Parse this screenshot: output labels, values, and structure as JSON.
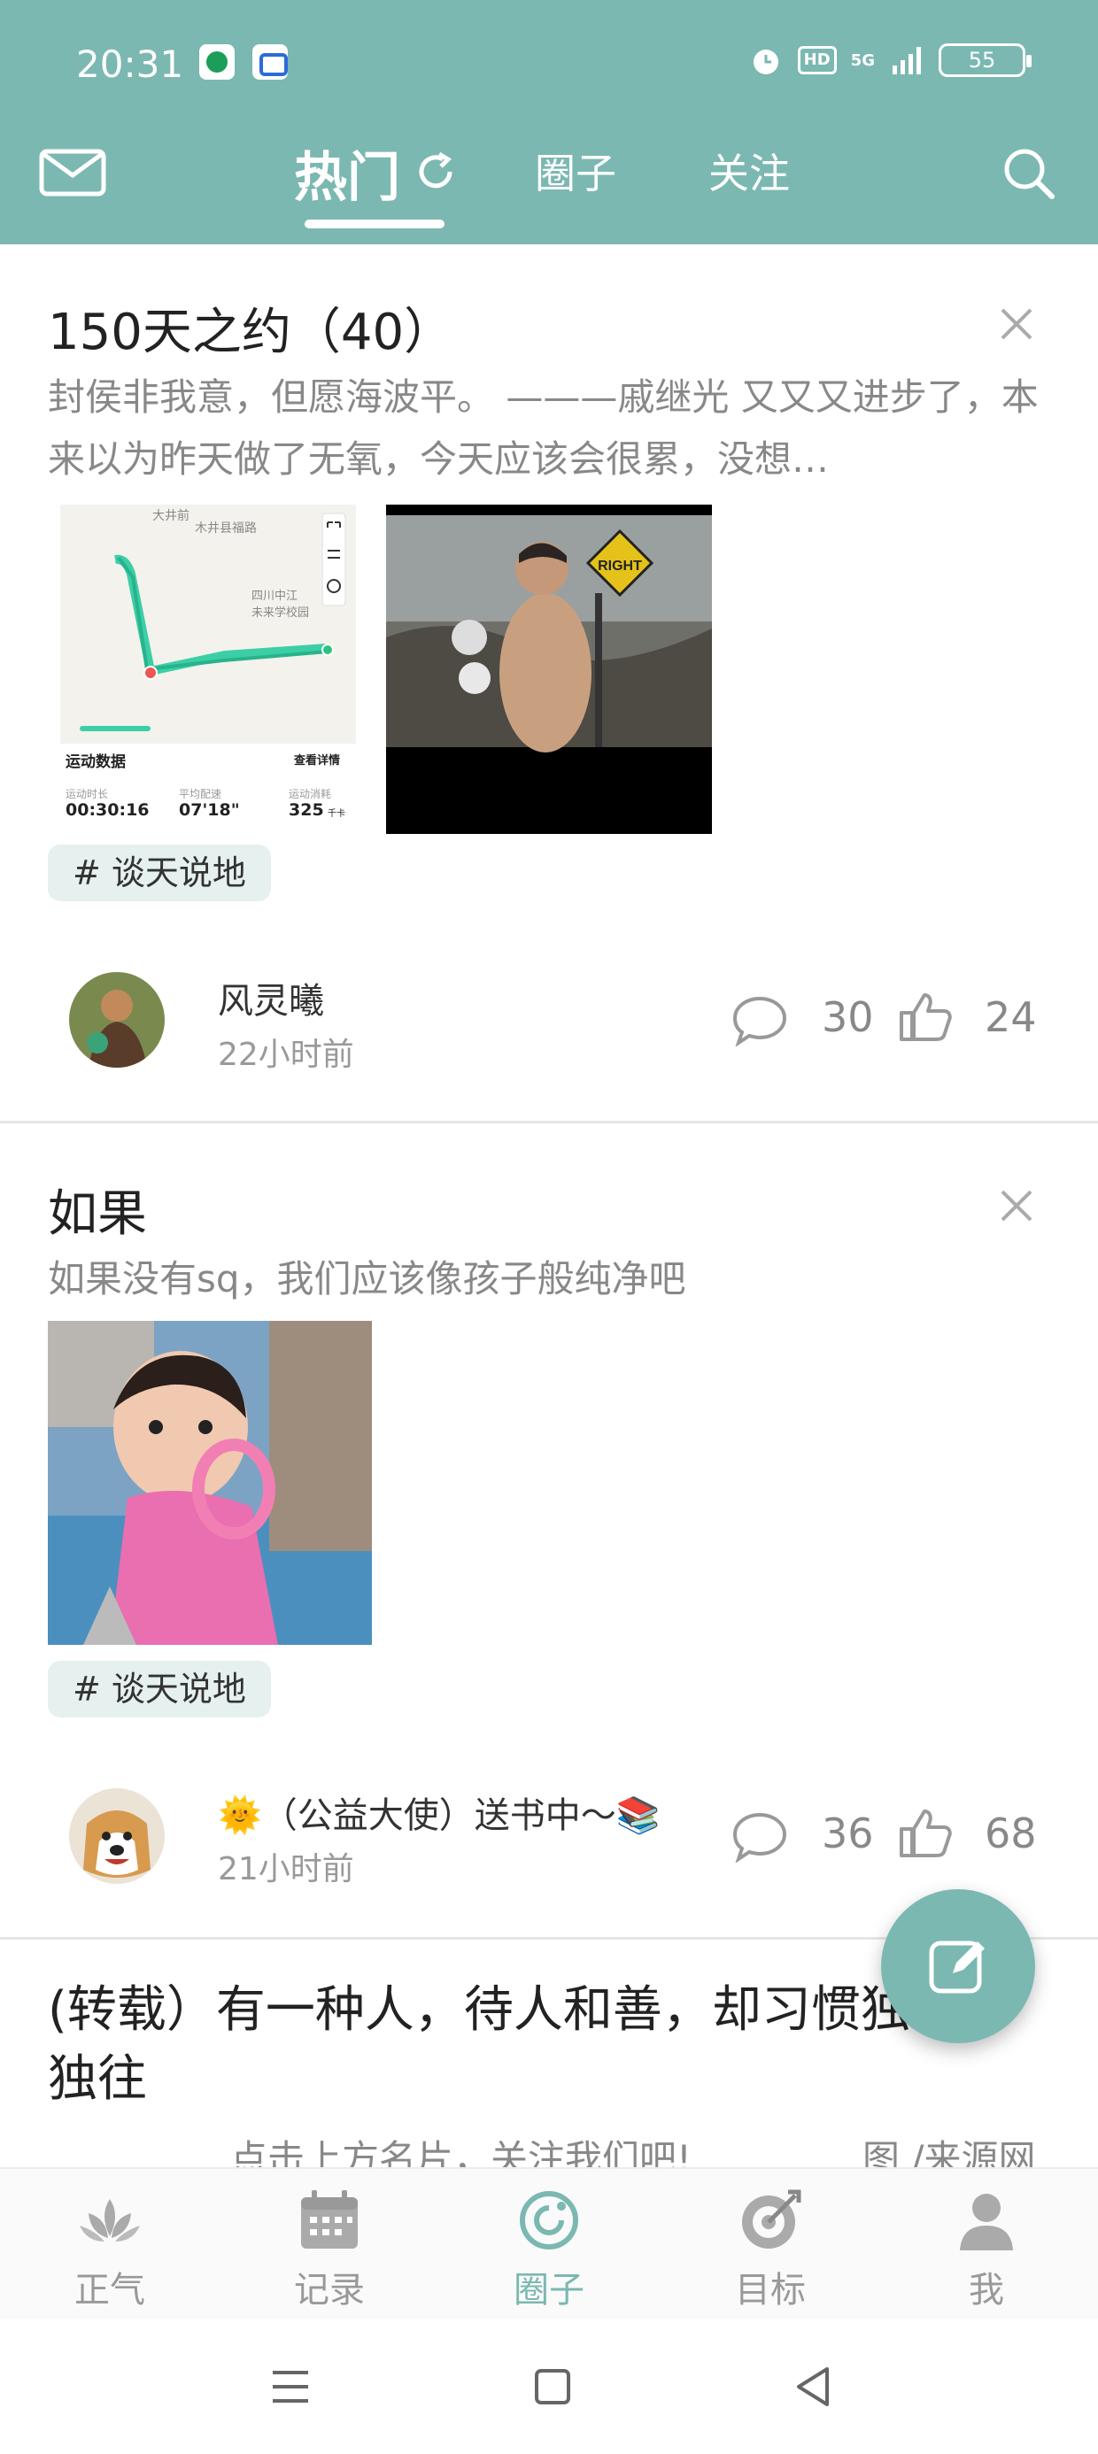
{
  "status_bar": {
    "time": "20:31",
    "network": "5G",
    "hd": "HD",
    "battery": "55"
  },
  "top_nav": {
    "tabs": [
      {
        "label": "热门",
        "active": true
      },
      {
        "label": "圈子",
        "active": false
      },
      {
        "label": "关注",
        "active": false
      }
    ],
    "icons": [
      "mail-icon",
      "refresh-icon",
      "search-icon"
    ]
  },
  "posts": [
    {
      "title": "150天之约（40）",
      "excerpt": "封侯非我意，但愿海波平。 ———戚继光 又又又进步了，本来以为昨天做了无氧，今天应该会很累，没想…",
      "map": {
        "top_label": "大井前",
        "street": "木井县福路",
        "place": "四川中江\n未来学校园",
        "section": "运动数据",
        "details": "查看详情",
        "stats": [
          {
            "label": "运动时长",
            "value": "00:30:16"
          },
          {
            "label": "平均配速",
            "value": "07'18\""
          },
          {
            "label": "运动消耗",
            "value": "325",
            "unit": "千卡"
          }
        ]
      },
      "sign_text": "RIGHT",
      "tag": "# 谈天说地",
      "author": "风灵曦",
      "time": "22小时前",
      "comments": "30",
      "likes": "24"
    },
    {
      "title": "如果",
      "excerpt": "如果没有sq，我们应该像孩子般纯净吧",
      "tag": "# 谈天说地",
      "author": "🌞（公益大使）送书中～📚",
      "time": "21小时前",
      "comments": "36",
      "likes": "68"
    },
    {
      "title": "(转载）有一种人，待人和善，却习惯独来独往",
      "excerpt_left": "点击上方名片，关注我们吧!",
      "excerpt_right": "图 /来源网"
    }
  ],
  "bottom_nav": [
    {
      "label": "正气",
      "icon": "lotus-icon",
      "active": false
    },
    {
      "label": "记录",
      "icon": "calendar-icon",
      "active": false
    },
    {
      "label": "圈子",
      "icon": "circle-icon",
      "active": true
    },
    {
      "label": "目标",
      "icon": "target-icon",
      "active": false
    },
    {
      "label": "我",
      "icon": "user-icon",
      "active": false
    }
  ],
  "colors": {
    "accent": "#7bb8b1",
    "tag_bg": "#e6f1ef",
    "text_muted": "#888888"
  }
}
